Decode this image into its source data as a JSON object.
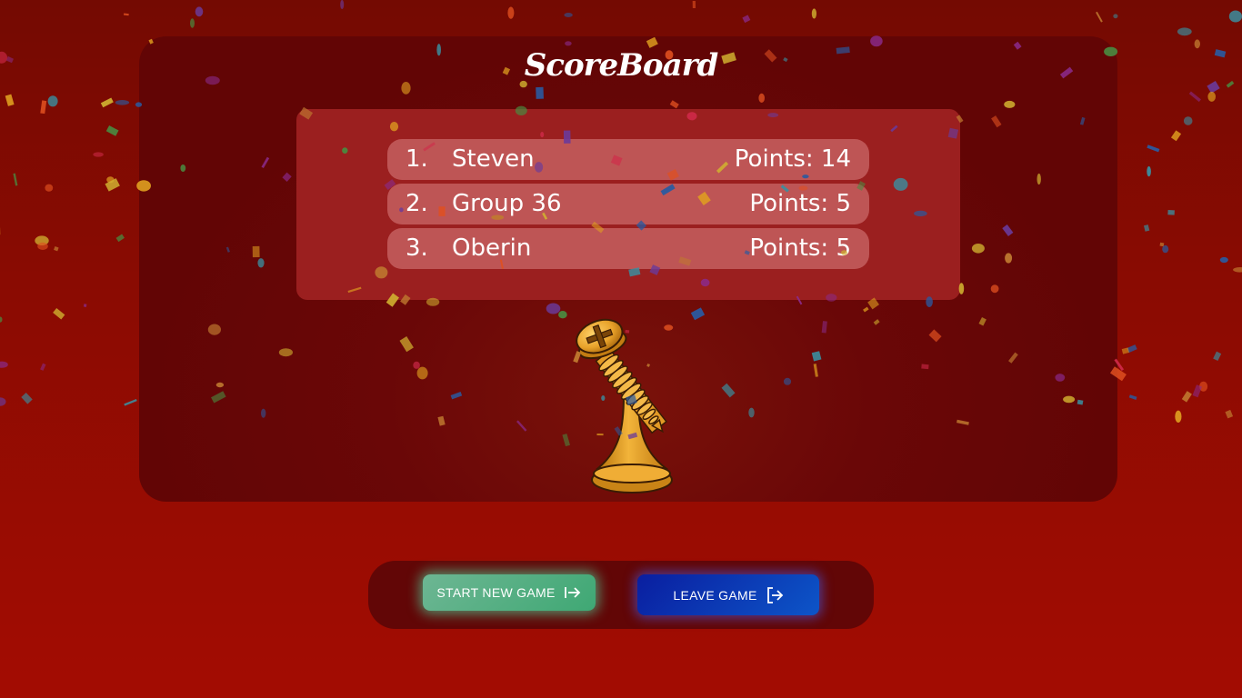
{
  "title": "ScoreBoard",
  "scores": [
    {
      "rank": "1.",
      "name": "Steven",
      "points": "Points: 14"
    },
    {
      "rank": "2.",
      "name": "Group 36",
      "points": "Points: 5"
    },
    {
      "rank": "3.",
      "name": "Oberin",
      "points": "Points: 5"
    }
  ],
  "trophy_icon": "golden-screw-trophy",
  "buttons": {
    "start_new_game": "START NEW GAME",
    "start_icon": "arrow-right-to-bar-icon",
    "leave_game": "LEAVE GAME",
    "leave_icon": "sign-out-icon"
  },
  "colors": {
    "background": "#a30c02",
    "board": "#620505",
    "ranking_panel": "#9b1f1f",
    "start_button": "#50b184",
    "leave_button": "#0a2ab0"
  }
}
